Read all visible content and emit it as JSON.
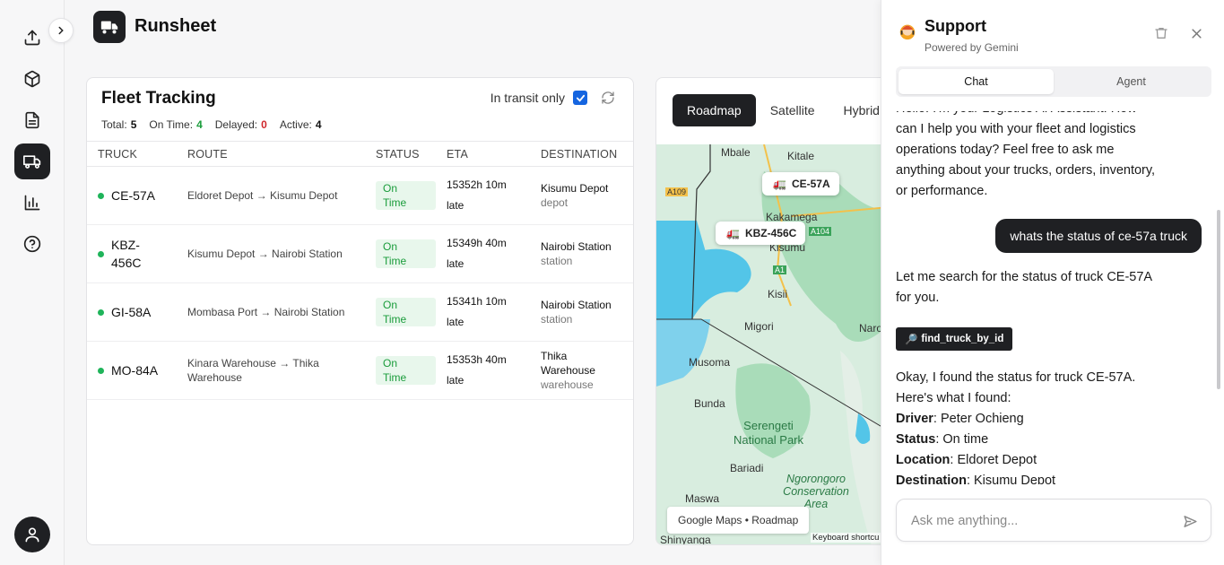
{
  "app": {
    "title": "Runsheet"
  },
  "rail": {
    "items": [
      {
        "icon": "upload-icon"
      },
      {
        "icon": "package-icon"
      },
      {
        "icon": "document-icon"
      },
      {
        "icon": "truck-icon",
        "active": true
      },
      {
        "icon": "bar-chart-icon"
      },
      {
        "icon": "help-icon"
      }
    ]
  },
  "fleet": {
    "title": "Fleet Tracking",
    "transit_label": "In transit only",
    "transit_checked": true,
    "stats": {
      "total_label": "Total:",
      "total": "5",
      "on_time_label": "On Time:",
      "on_time": "4",
      "delayed_label": "Delayed:",
      "delayed": "0",
      "active_label": "Active:",
      "active": "4"
    },
    "columns": [
      "TRUCK",
      "ROUTE",
      "STATUS",
      "ETA",
      "DESTINATION"
    ],
    "rows": [
      {
        "truck": "CE-57A",
        "route": "Eldoret Depot → Kisumu Depot",
        "status": "On Time",
        "eta1": "15352h 10m",
        "eta2": "late",
        "dest": "Kisumu Depot",
        "dest_type": "depot"
      },
      {
        "truck": "KBZ-456C",
        "route": "Kisumu Depot → Nairobi Station",
        "status": "On Time",
        "eta1": "15349h 40m",
        "eta2": "late",
        "dest": "Nairobi Station",
        "dest_type": "station"
      },
      {
        "truck": "GI-58A",
        "route": "Mombasa Port → Nairobi Station",
        "status": "On Time",
        "eta1": "15341h 10m",
        "eta2": "late",
        "dest": "Nairobi Station",
        "dest_type": "station"
      },
      {
        "truck": "MO-84A",
        "route": "Kinara Warehouse → Thika Warehouse",
        "status": "On Time",
        "eta1": "15353h 40m",
        "eta2": "late",
        "dest": "Thika Warehouse",
        "dest_type": "warehouse"
      }
    ]
  },
  "map": {
    "tabs": [
      "Roadmap",
      "Satellite",
      "Hybrid"
    ],
    "active_tab": "Roadmap",
    "markers": [
      "CE-57A",
      "KBZ-456C"
    ],
    "places": [
      "Mbale",
      "Kitale",
      "Kakamega",
      "Kisumu",
      "Kisii",
      "Migori",
      "Musoma",
      "Bunda",
      "Bariadi",
      "Maswa",
      "Shinyanga",
      "Narok",
      "Serengeti National Park",
      "Ngorongoro Conservation Area"
    ],
    "roads": [
      "A109",
      "A104",
      "A1"
    ],
    "caption": "Google Maps • Roadmap",
    "keyboard": "Keyboard shortcu"
  },
  "support": {
    "title": "Support",
    "subtitle": "Powered by Gemini",
    "tabs": [
      "Chat",
      "Agent"
    ],
    "active_tab": "Chat",
    "intro": "Hello! I'm your Logistics AI Assistant. How can I help you with your fleet and logistics operations today? Feel free to ask me anything about your trucks, orders, inventory, or performance.",
    "user_message": "whats the status of ce-57a truck",
    "reply1": "Let me search for the status of truck CE-57A for you.",
    "tool": "find_truck_by_id",
    "reply2": "Okay, I found the status for truck CE-57A. Here's what I found:",
    "details": [
      {
        "label": "Driver",
        "value": "Peter Ochieng"
      },
      {
        "label": "Status",
        "value": "On time"
      },
      {
        "label": "Location",
        "value": "Eldoret Depot"
      },
      {
        "label": "Destination",
        "value": "Kisumu Depot"
      }
    ],
    "input_placeholder": "Ask me anything..."
  }
}
